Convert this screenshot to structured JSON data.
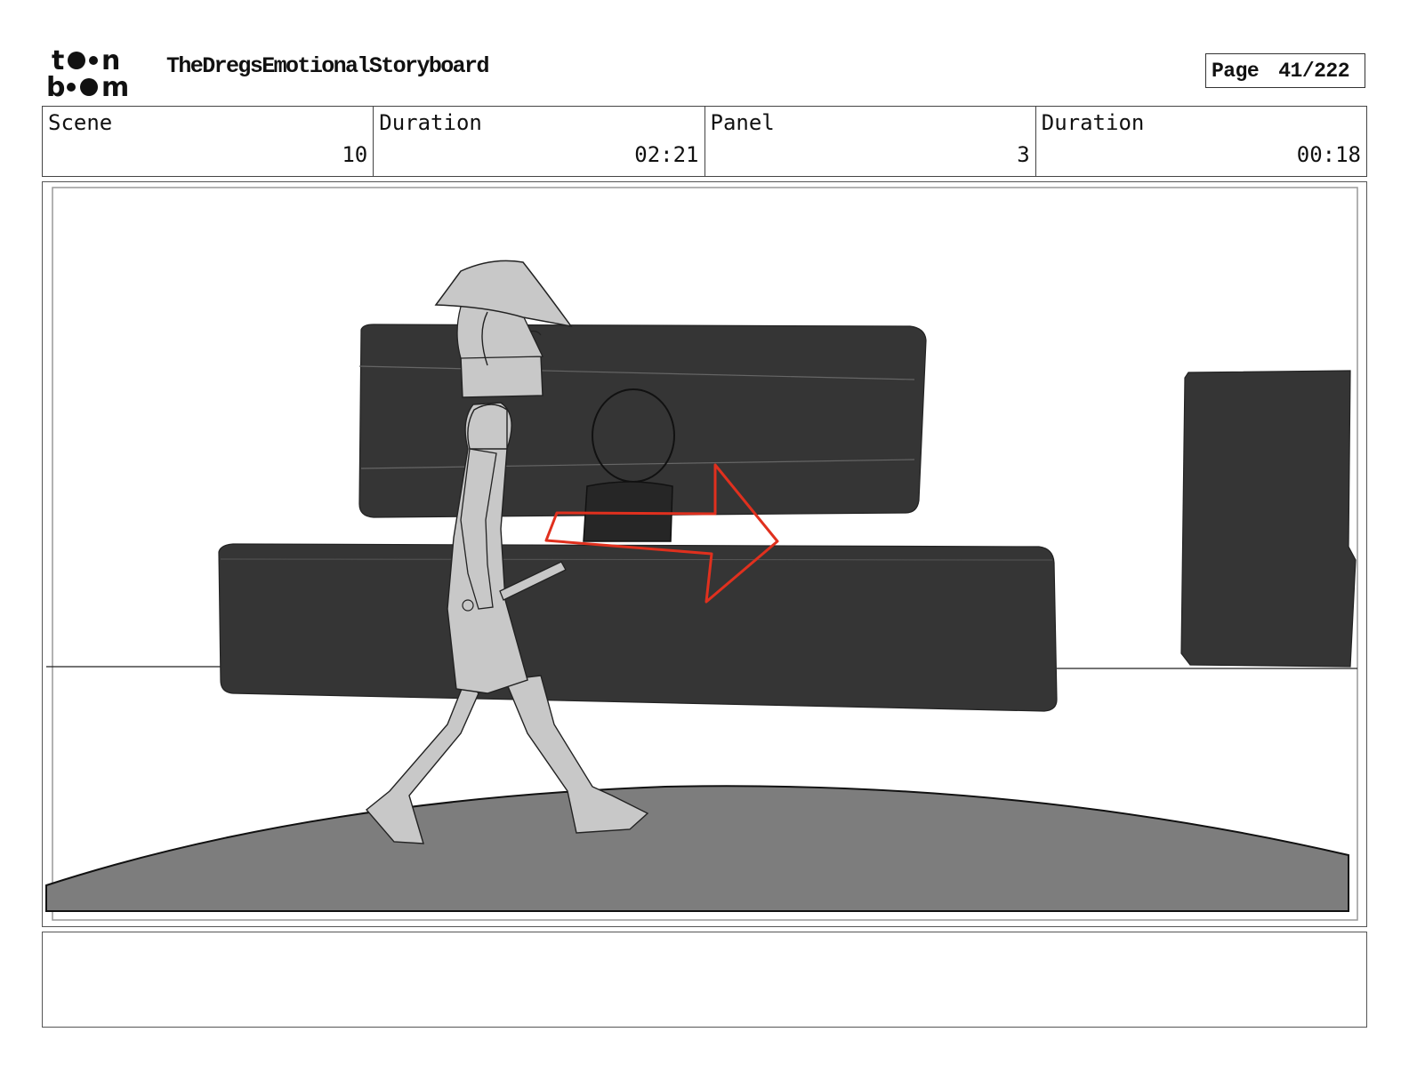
{
  "header": {
    "logo_top": "toon",
    "logo_bottom": "boom",
    "title": "TheDregsEmotionalStoryboard",
    "page_label": "Page",
    "page_value": "41/222"
  },
  "info": {
    "scene_label": "Scene",
    "scene_value": "10",
    "scene_duration_label": "Duration",
    "scene_duration_value": "02:21",
    "panel_label": "Panel",
    "panel_value": "3",
    "panel_duration_label": "Duration",
    "panel_duration_value": "00:18"
  },
  "panel": {
    "colors": {
      "dark": "#353535",
      "ground": "#7d7d7d",
      "figure": "#c8c8c8",
      "arrow": "#e0301e"
    }
  },
  "notes": {
    "text": ""
  }
}
